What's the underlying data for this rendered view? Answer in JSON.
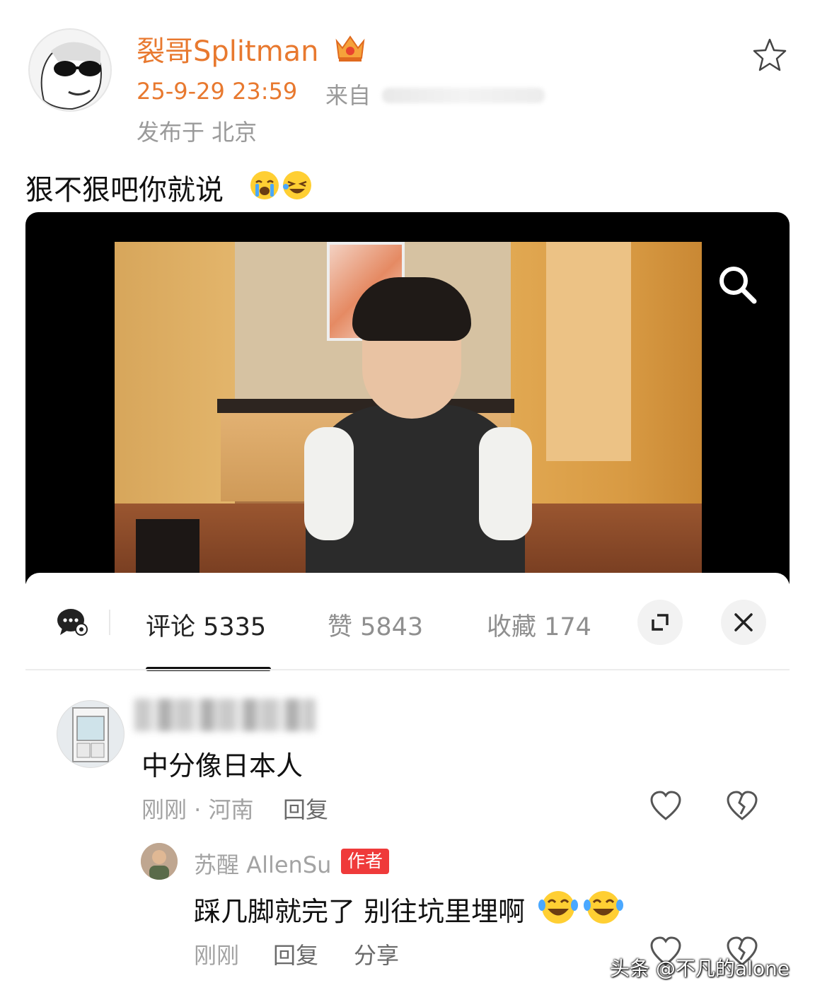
{
  "post": {
    "username": "裂哥Splitman",
    "timestamp": "25-9-29 23:59",
    "source_prefix": "来自",
    "location": "发布于 北京",
    "text": "狠不狠吧你就说",
    "text_emojis": [
      "crying-face-emoji",
      "laughing-face-emoji"
    ]
  },
  "comments_panel": {
    "tabs": [
      {
        "label": "评论 5335",
        "active": true
      },
      {
        "label": "赞 5843",
        "active": false
      },
      {
        "label": "收藏 174",
        "active": false
      }
    ],
    "icons": [
      "comment-bubble-icon",
      "expand-icon",
      "close-icon"
    ]
  },
  "comment": {
    "text": "中分像日本人",
    "meta": "刚刚 · 河南",
    "reply_label": "回复"
  },
  "reply": {
    "username": "苏醒 AllenSu",
    "badge": "作者",
    "text": "踩几脚就完了 别往坑里埋啊",
    "text_emojis": [
      "laughing-tears-emoji",
      "laughing-tears-emoji"
    ],
    "meta": "刚刚",
    "reply_label": "回复",
    "share_label": "分享"
  },
  "watermark": "头条 @不凡的alone",
  "colors": {
    "username": "#e8792f",
    "badge": "#ef3a3a",
    "muted": "#a3a3a3"
  }
}
